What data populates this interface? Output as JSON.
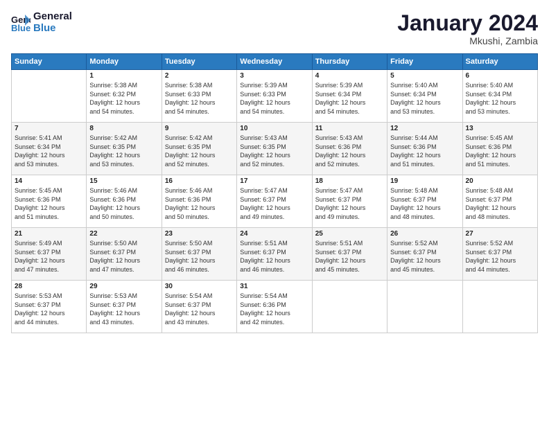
{
  "header": {
    "logo_line1": "General",
    "logo_line2": "Blue",
    "month": "January 2024",
    "location": "Mkushi, Zambia"
  },
  "weekdays": [
    "Sunday",
    "Monday",
    "Tuesday",
    "Wednesday",
    "Thursday",
    "Friday",
    "Saturday"
  ],
  "weeks": [
    [
      {
        "day": "",
        "info": ""
      },
      {
        "day": "1",
        "info": "Sunrise: 5:38 AM\nSunset: 6:32 PM\nDaylight: 12 hours\nand 54 minutes."
      },
      {
        "day": "2",
        "info": "Sunrise: 5:38 AM\nSunset: 6:33 PM\nDaylight: 12 hours\nand 54 minutes."
      },
      {
        "day": "3",
        "info": "Sunrise: 5:39 AM\nSunset: 6:33 PM\nDaylight: 12 hours\nand 54 minutes."
      },
      {
        "day": "4",
        "info": "Sunrise: 5:39 AM\nSunset: 6:34 PM\nDaylight: 12 hours\nand 54 minutes."
      },
      {
        "day": "5",
        "info": "Sunrise: 5:40 AM\nSunset: 6:34 PM\nDaylight: 12 hours\nand 53 minutes."
      },
      {
        "day": "6",
        "info": "Sunrise: 5:40 AM\nSunset: 6:34 PM\nDaylight: 12 hours\nand 53 minutes."
      }
    ],
    [
      {
        "day": "7",
        "info": "Sunrise: 5:41 AM\nSunset: 6:34 PM\nDaylight: 12 hours\nand 53 minutes."
      },
      {
        "day": "8",
        "info": "Sunrise: 5:42 AM\nSunset: 6:35 PM\nDaylight: 12 hours\nand 53 minutes."
      },
      {
        "day": "9",
        "info": "Sunrise: 5:42 AM\nSunset: 6:35 PM\nDaylight: 12 hours\nand 52 minutes."
      },
      {
        "day": "10",
        "info": "Sunrise: 5:43 AM\nSunset: 6:35 PM\nDaylight: 12 hours\nand 52 minutes."
      },
      {
        "day": "11",
        "info": "Sunrise: 5:43 AM\nSunset: 6:36 PM\nDaylight: 12 hours\nand 52 minutes."
      },
      {
        "day": "12",
        "info": "Sunrise: 5:44 AM\nSunset: 6:36 PM\nDaylight: 12 hours\nand 51 minutes."
      },
      {
        "day": "13",
        "info": "Sunrise: 5:45 AM\nSunset: 6:36 PM\nDaylight: 12 hours\nand 51 minutes."
      }
    ],
    [
      {
        "day": "14",
        "info": "Sunrise: 5:45 AM\nSunset: 6:36 PM\nDaylight: 12 hours\nand 51 minutes."
      },
      {
        "day": "15",
        "info": "Sunrise: 5:46 AM\nSunset: 6:36 PM\nDaylight: 12 hours\nand 50 minutes."
      },
      {
        "day": "16",
        "info": "Sunrise: 5:46 AM\nSunset: 6:36 PM\nDaylight: 12 hours\nand 50 minutes."
      },
      {
        "day": "17",
        "info": "Sunrise: 5:47 AM\nSunset: 6:37 PM\nDaylight: 12 hours\nand 49 minutes."
      },
      {
        "day": "18",
        "info": "Sunrise: 5:47 AM\nSunset: 6:37 PM\nDaylight: 12 hours\nand 49 minutes."
      },
      {
        "day": "19",
        "info": "Sunrise: 5:48 AM\nSunset: 6:37 PM\nDaylight: 12 hours\nand 48 minutes."
      },
      {
        "day": "20",
        "info": "Sunrise: 5:48 AM\nSunset: 6:37 PM\nDaylight: 12 hours\nand 48 minutes."
      }
    ],
    [
      {
        "day": "21",
        "info": "Sunrise: 5:49 AM\nSunset: 6:37 PM\nDaylight: 12 hours\nand 47 minutes."
      },
      {
        "day": "22",
        "info": "Sunrise: 5:50 AM\nSunset: 6:37 PM\nDaylight: 12 hours\nand 47 minutes."
      },
      {
        "day": "23",
        "info": "Sunrise: 5:50 AM\nSunset: 6:37 PM\nDaylight: 12 hours\nand 46 minutes."
      },
      {
        "day": "24",
        "info": "Sunrise: 5:51 AM\nSunset: 6:37 PM\nDaylight: 12 hours\nand 46 minutes."
      },
      {
        "day": "25",
        "info": "Sunrise: 5:51 AM\nSunset: 6:37 PM\nDaylight: 12 hours\nand 45 minutes."
      },
      {
        "day": "26",
        "info": "Sunrise: 5:52 AM\nSunset: 6:37 PM\nDaylight: 12 hours\nand 45 minutes."
      },
      {
        "day": "27",
        "info": "Sunrise: 5:52 AM\nSunset: 6:37 PM\nDaylight: 12 hours\nand 44 minutes."
      }
    ],
    [
      {
        "day": "28",
        "info": "Sunrise: 5:53 AM\nSunset: 6:37 PM\nDaylight: 12 hours\nand 44 minutes."
      },
      {
        "day": "29",
        "info": "Sunrise: 5:53 AM\nSunset: 6:37 PM\nDaylight: 12 hours\nand 43 minutes."
      },
      {
        "day": "30",
        "info": "Sunrise: 5:54 AM\nSunset: 6:37 PM\nDaylight: 12 hours\nand 43 minutes."
      },
      {
        "day": "31",
        "info": "Sunrise: 5:54 AM\nSunset: 6:36 PM\nDaylight: 12 hours\nand 42 minutes."
      },
      {
        "day": "",
        "info": ""
      },
      {
        "day": "",
        "info": ""
      },
      {
        "day": "",
        "info": ""
      }
    ]
  ]
}
